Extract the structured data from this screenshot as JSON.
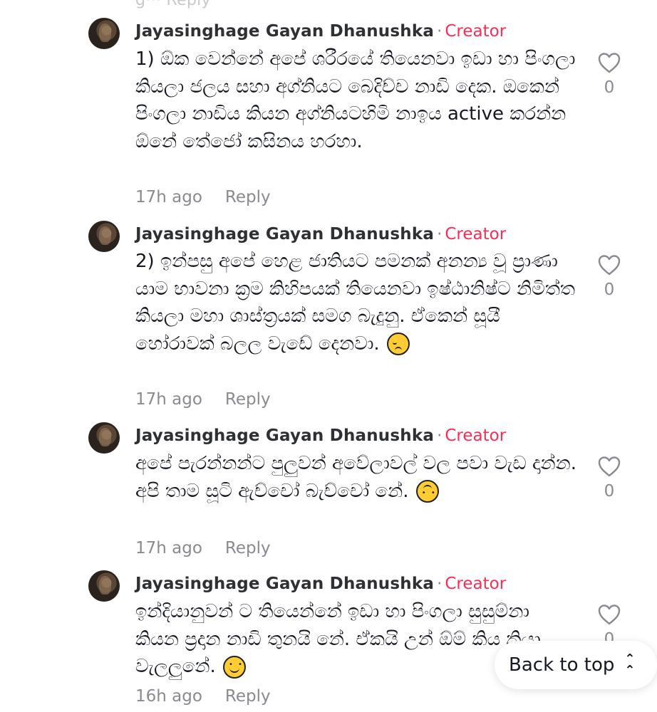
{
  "top_partial": "g··· Reply",
  "comments": [
    {
      "author": "Jayasinghage Gayan Dhanushka",
      "separator": "·",
      "badge": "Creator",
      "text": "1) ඕක වෙන්නේ අපේ ශරීරයේ තියෙනවා ඉඩා හා පිංගලා කියලා ජලය සහා අග්නියට බෙදිච්ච නාඩි දෙක. ඔකෙන් පිංගලා නාඩිය කියන අග්නියටහිමි නාඉය active කරන්න ඕනේ තේජෝ කසිනය හරහා.",
      "emoji": "",
      "time": "17h ago",
      "reply": "Reply",
      "likes": "0"
    },
    {
      "author": "Jayasinghage Gayan Dhanushka",
      "separator": "·",
      "badge": "Creator",
      "text": "2) ඉන්පසු අපේ හෙළ ජාතියට පමනක් අනන්‍ය වූ ප්‍රාණා යාම භාවනා ක්‍රම කිහිපයක් තියෙනවා ඉෂ්ඨානිෂ්ට නිමිත්ත කියලා මහා ශාස්ත්‍රයක් සමග බැදුනු. ඒකෙන් සූයී හෝරාවක් බලල වැඩේ දෙනවා.",
      "emoji": "pensive",
      "time": "17h ago",
      "reply": "Reply",
      "likes": "0"
    },
    {
      "author": "Jayasinghage Gayan Dhanushka",
      "separator": "·",
      "badge": "Creator",
      "text": "අපේ පැරන්නන්ට පුලුවන් අවේලාවල් වල පවා වැඩ දාන්න. අපි තාම සූටි ඇච්චෝ බැච්චෝ නේ.",
      "emoji": "upside",
      "time": "17h ago",
      "reply": "Reply",
      "likes": "0"
    },
    {
      "author": "Jayasinghage Gayan Dhanushka",
      "separator": "·",
      "badge": "Creator",
      "text": "ඉන්දියානුවන් ට තියෙන්නේ ඉඩා හා පිංගලා සුසුම්නා කියන ප්‍රදාන නාඩි තුනයි නේ. ඒකයි උන් ඕම් කිය කියා වැලලුනේ.",
      "emoji": "smile",
      "time": "16h ago",
      "reply": "Reply",
      "likes": "0"
    }
  ],
  "back_to_top": "Back to top",
  "colors": {
    "creator": "#fe2c55",
    "meta": "#8a8b91",
    "text": "#161823"
  },
  "icons": {
    "like": "heart-outline-icon",
    "back_to_top": "double-chevron-up-icon"
  }
}
